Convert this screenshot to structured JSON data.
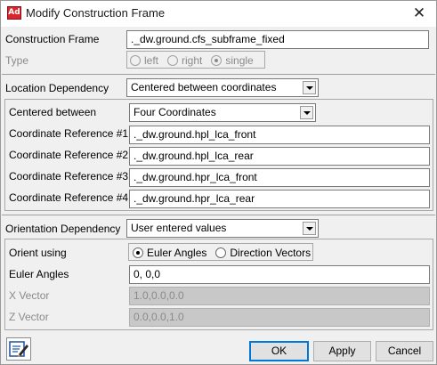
{
  "window": {
    "title": "Modify Construction Frame",
    "app_icon_text": "Ad",
    "close_glyph": "✕"
  },
  "construction_frame": {
    "label": "Construction Frame",
    "value": "._dw.ground.cfs_subframe_fixed"
  },
  "type": {
    "label": "Type",
    "options": [
      "left",
      "right",
      "single"
    ],
    "selected": "single"
  },
  "location": {
    "label": "Location Dependency",
    "selected": "Centered between coordinates",
    "centered_between_label": "Centered between",
    "centered_between_value": "Four Coordinates",
    "refs": [
      {
        "label": "Coordinate Reference #1",
        "value": "._dw.ground.hpl_lca_front"
      },
      {
        "label": "Coordinate Reference #2",
        "value": "._dw.ground.hpl_lca_rear"
      },
      {
        "label": "Coordinate Reference #3",
        "value": "._dw.ground.hpr_lca_front"
      },
      {
        "label": "Coordinate Reference #4",
        "value": "._dw.ground.hpr_lca_rear"
      }
    ]
  },
  "orientation": {
    "label": "Orientation Dependency",
    "selected": "User entered values",
    "orient_using_label": "Orient using",
    "orient_options": [
      "Euler Angles",
      "Direction Vectors"
    ],
    "orient_selected": "Euler Angles",
    "euler_label": "Euler Angles",
    "euler_value": "0, 0,0",
    "x_vector_label": "X Vector",
    "x_vector_value": "1.0,0.0,0.0",
    "z_vector_label": "Z Vector",
    "z_vector_value": "0.0,0.0,1.0"
  },
  "buttons": {
    "ok": "OK",
    "apply": "Apply",
    "cancel": "Cancel"
  }
}
